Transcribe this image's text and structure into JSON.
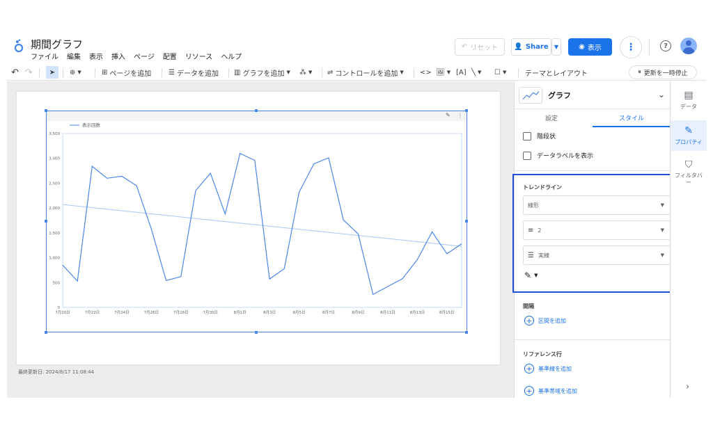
{
  "header": {
    "title": "期間グラフ",
    "menus": [
      "ファイル",
      "編集",
      "表示",
      "挿入",
      "ページ",
      "配置",
      "リソース",
      "ヘルプ"
    ],
    "reset_label": "リセット",
    "share_label": "Share",
    "view_label": "表示"
  },
  "toolbar": {
    "add_page": "ページを追加",
    "add_data": "データを追加",
    "add_chart": "グラフを追加",
    "add_control": "コントロールを追加",
    "theme_layout": "テーマとレイアウト",
    "pause_update": "更新を一時停止"
  },
  "canvas": {
    "last_updated": "最終更新日: 2024/8/17 11:08:44"
  },
  "panel": {
    "chart_type": "グラフ",
    "tabs": [
      "設定",
      "スタイル"
    ],
    "active_tab": "スタイル",
    "checkbox_step": "階段状",
    "checkbox_data_labels": "データラベルを表示",
    "trendline_label": "トレンドライン",
    "trend_type": "線形",
    "trend_weight": "2",
    "trend_style": "実線",
    "interval_label": "間隔",
    "add_interval": "区間を追加",
    "reference_label": "リファレンス行",
    "add_reference_line": "基準線を追加",
    "add_reference_band": "基準帯域を追加"
  },
  "rail": {
    "data": "データ",
    "properties": "プロパティ",
    "filter": "フィルタバー"
  },
  "colors": {
    "accent": "#1a73e8",
    "line": "#4a86e8",
    "trend": "#a8c7fa",
    "highlight_border": "#1e4fd8"
  },
  "chart_data": {
    "type": "line",
    "legend": "表示回数",
    "x": [
      "7月20日",
      "7月21日",
      "7月22日",
      "7月23日",
      "7月24日",
      "7月25日",
      "7月26日",
      "7月27日",
      "7月28日",
      "7月29日",
      "7月30日",
      "7月31日",
      "8月1日",
      "8月2日",
      "8月3日",
      "8月4日",
      "8月5日",
      "8月6日",
      "8月7日",
      "8月8日",
      "8月9日",
      "8月10日",
      "8月11日",
      "8月12日",
      "8月13日",
      "8月14日",
      "8月15日",
      "8月16日"
    ],
    "x_tick_labels": [
      "7月20日",
      "7月22日",
      "7月24日",
      "7月26日",
      "7月28日",
      "7月30日",
      "8月1日",
      "8月3日",
      "8月5日",
      "8月7日",
      "8月9日",
      "8月11日",
      "8月13日",
      "8月15日"
    ],
    "series": [
      {
        "name": "表示回数",
        "values": [
          850,
          530,
          2840,
          2600,
          2640,
          2450,
          1580,
          540,
          620,
          2350,
          2700,
          1880,
          3100,
          2960,
          570,
          780,
          2320,
          2890,
          3010,
          1760,
          1480,
          260,
          420,
          580,
          960,
          1520,
          1080,
          1280
        ]
      }
    ],
    "trendline": {
      "type": "linear",
      "start": 2070,
      "end": 1230
    },
    "y_ticks": [
      0,
      500,
      "1,000",
      "1,500",
      "2,000",
      "2,500",
      "3,000",
      "3,500"
    ],
    "ylim": [
      0,
      3500
    ]
  }
}
